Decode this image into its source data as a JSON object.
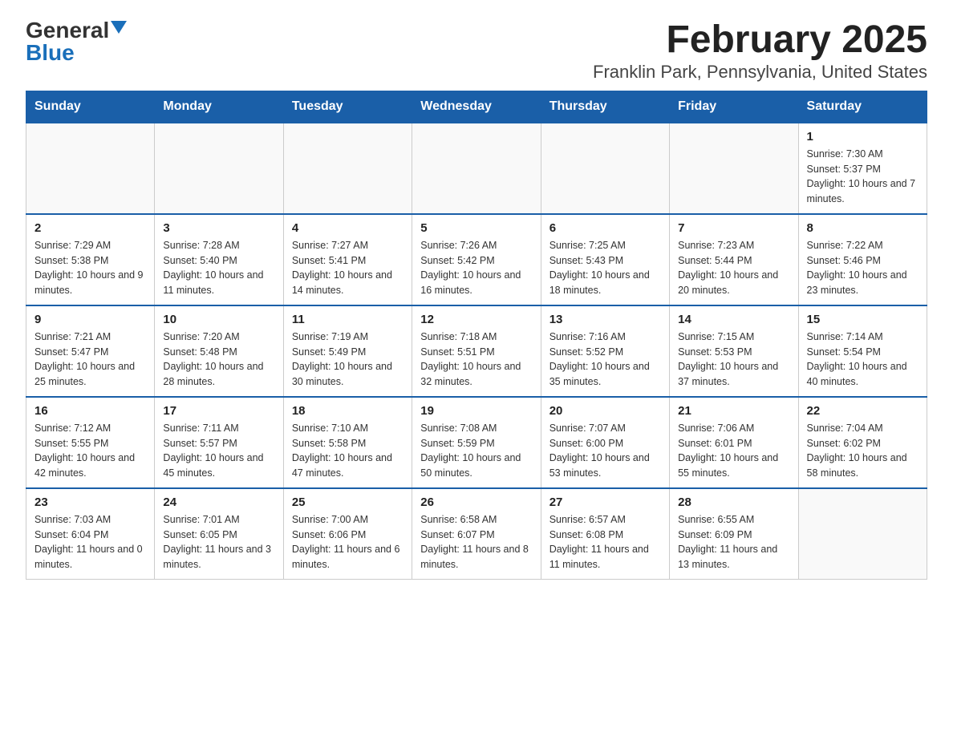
{
  "header": {
    "logo_general": "General",
    "logo_blue": "Blue",
    "title": "February 2025",
    "subtitle": "Franklin Park, Pennsylvania, United States"
  },
  "days_of_week": [
    "Sunday",
    "Monday",
    "Tuesday",
    "Wednesday",
    "Thursday",
    "Friday",
    "Saturday"
  ],
  "weeks": [
    [
      {
        "day": "",
        "info": ""
      },
      {
        "day": "",
        "info": ""
      },
      {
        "day": "",
        "info": ""
      },
      {
        "day": "",
        "info": ""
      },
      {
        "day": "",
        "info": ""
      },
      {
        "day": "",
        "info": ""
      },
      {
        "day": "1",
        "info": "Sunrise: 7:30 AM\nSunset: 5:37 PM\nDaylight: 10 hours and 7 minutes."
      }
    ],
    [
      {
        "day": "2",
        "info": "Sunrise: 7:29 AM\nSunset: 5:38 PM\nDaylight: 10 hours and 9 minutes."
      },
      {
        "day": "3",
        "info": "Sunrise: 7:28 AM\nSunset: 5:40 PM\nDaylight: 10 hours and 11 minutes."
      },
      {
        "day": "4",
        "info": "Sunrise: 7:27 AM\nSunset: 5:41 PM\nDaylight: 10 hours and 14 minutes."
      },
      {
        "day": "5",
        "info": "Sunrise: 7:26 AM\nSunset: 5:42 PM\nDaylight: 10 hours and 16 minutes."
      },
      {
        "day": "6",
        "info": "Sunrise: 7:25 AM\nSunset: 5:43 PM\nDaylight: 10 hours and 18 minutes."
      },
      {
        "day": "7",
        "info": "Sunrise: 7:23 AM\nSunset: 5:44 PM\nDaylight: 10 hours and 20 minutes."
      },
      {
        "day": "8",
        "info": "Sunrise: 7:22 AM\nSunset: 5:46 PM\nDaylight: 10 hours and 23 minutes."
      }
    ],
    [
      {
        "day": "9",
        "info": "Sunrise: 7:21 AM\nSunset: 5:47 PM\nDaylight: 10 hours and 25 minutes."
      },
      {
        "day": "10",
        "info": "Sunrise: 7:20 AM\nSunset: 5:48 PM\nDaylight: 10 hours and 28 minutes."
      },
      {
        "day": "11",
        "info": "Sunrise: 7:19 AM\nSunset: 5:49 PM\nDaylight: 10 hours and 30 minutes."
      },
      {
        "day": "12",
        "info": "Sunrise: 7:18 AM\nSunset: 5:51 PM\nDaylight: 10 hours and 32 minutes."
      },
      {
        "day": "13",
        "info": "Sunrise: 7:16 AM\nSunset: 5:52 PM\nDaylight: 10 hours and 35 minutes."
      },
      {
        "day": "14",
        "info": "Sunrise: 7:15 AM\nSunset: 5:53 PM\nDaylight: 10 hours and 37 minutes."
      },
      {
        "day": "15",
        "info": "Sunrise: 7:14 AM\nSunset: 5:54 PM\nDaylight: 10 hours and 40 minutes."
      }
    ],
    [
      {
        "day": "16",
        "info": "Sunrise: 7:12 AM\nSunset: 5:55 PM\nDaylight: 10 hours and 42 minutes."
      },
      {
        "day": "17",
        "info": "Sunrise: 7:11 AM\nSunset: 5:57 PM\nDaylight: 10 hours and 45 minutes."
      },
      {
        "day": "18",
        "info": "Sunrise: 7:10 AM\nSunset: 5:58 PM\nDaylight: 10 hours and 47 minutes."
      },
      {
        "day": "19",
        "info": "Sunrise: 7:08 AM\nSunset: 5:59 PM\nDaylight: 10 hours and 50 minutes."
      },
      {
        "day": "20",
        "info": "Sunrise: 7:07 AM\nSunset: 6:00 PM\nDaylight: 10 hours and 53 minutes."
      },
      {
        "day": "21",
        "info": "Sunrise: 7:06 AM\nSunset: 6:01 PM\nDaylight: 10 hours and 55 minutes."
      },
      {
        "day": "22",
        "info": "Sunrise: 7:04 AM\nSunset: 6:02 PM\nDaylight: 10 hours and 58 minutes."
      }
    ],
    [
      {
        "day": "23",
        "info": "Sunrise: 7:03 AM\nSunset: 6:04 PM\nDaylight: 11 hours and 0 minutes."
      },
      {
        "day": "24",
        "info": "Sunrise: 7:01 AM\nSunset: 6:05 PM\nDaylight: 11 hours and 3 minutes."
      },
      {
        "day": "25",
        "info": "Sunrise: 7:00 AM\nSunset: 6:06 PM\nDaylight: 11 hours and 6 minutes."
      },
      {
        "day": "26",
        "info": "Sunrise: 6:58 AM\nSunset: 6:07 PM\nDaylight: 11 hours and 8 minutes."
      },
      {
        "day": "27",
        "info": "Sunrise: 6:57 AM\nSunset: 6:08 PM\nDaylight: 11 hours and 11 minutes."
      },
      {
        "day": "28",
        "info": "Sunrise: 6:55 AM\nSunset: 6:09 PM\nDaylight: 11 hours and 13 minutes."
      },
      {
        "day": "",
        "info": ""
      }
    ]
  ]
}
